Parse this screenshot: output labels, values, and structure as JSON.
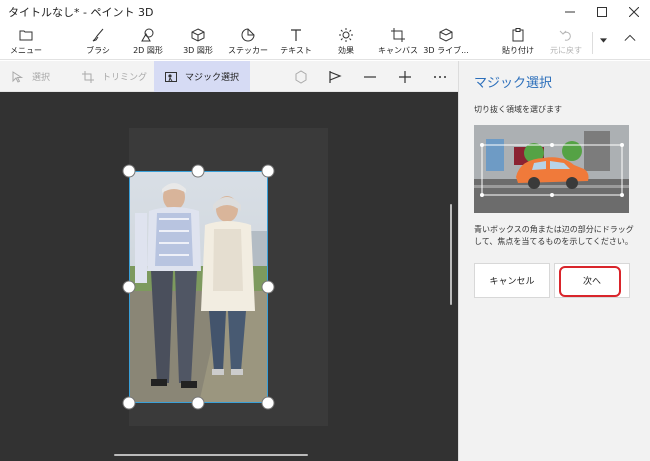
{
  "window": {
    "title": "タイトルなし* - ペイント 3D"
  },
  "ribbon": {
    "items": [
      {
        "label": "メニュー",
        "icon": "folder-icon"
      },
      {
        "label": "ブラシ",
        "icon": "brush-icon"
      },
      {
        "label": "2D 図形",
        "icon": "2d-shapes-icon"
      },
      {
        "label": "3D 図形",
        "icon": "3d-shapes-icon"
      },
      {
        "label": "ステッカー",
        "icon": "sticker-icon"
      },
      {
        "label": "テキスト",
        "icon": "text-icon"
      },
      {
        "label": "効果",
        "icon": "effects-icon"
      },
      {
        "label": "キャンバス",
        "icon": "canvas-icon"
      },
      {
        "label": "3D ライブ...",
        "icon": "3d-library-icon"
      },
      {
        "label": "貼り付け",
        "icon": "paste-icon"
      },
      {
        "label": "元に戻す",
        "icon": "undo-icon"
      }
    ]
  },
  "subtoolbar": {
    "select_label": "選択",
    "crop_label": "トリミング",
    "magic_select_label": "マジック選択"
  },
  "panel": {
    "title": "マジック選択",
    "description": "切り抜く領域を選びます",
    "body": "青いボックスの角または辺の部分にドラッグして、焦点を当てるものを示してください。",
    "cancel_label": "キャンセル",
    "next_label": "次へ"
  },
  "colors": {
    "accent": "#2c6fbb",
    "selection": "#3aa0d8",
    "highlight_ring": "#d9252b",
    "active_tool_bg": "#d6dbf4",
    "canvas_bg": "#323232"
  }
}
